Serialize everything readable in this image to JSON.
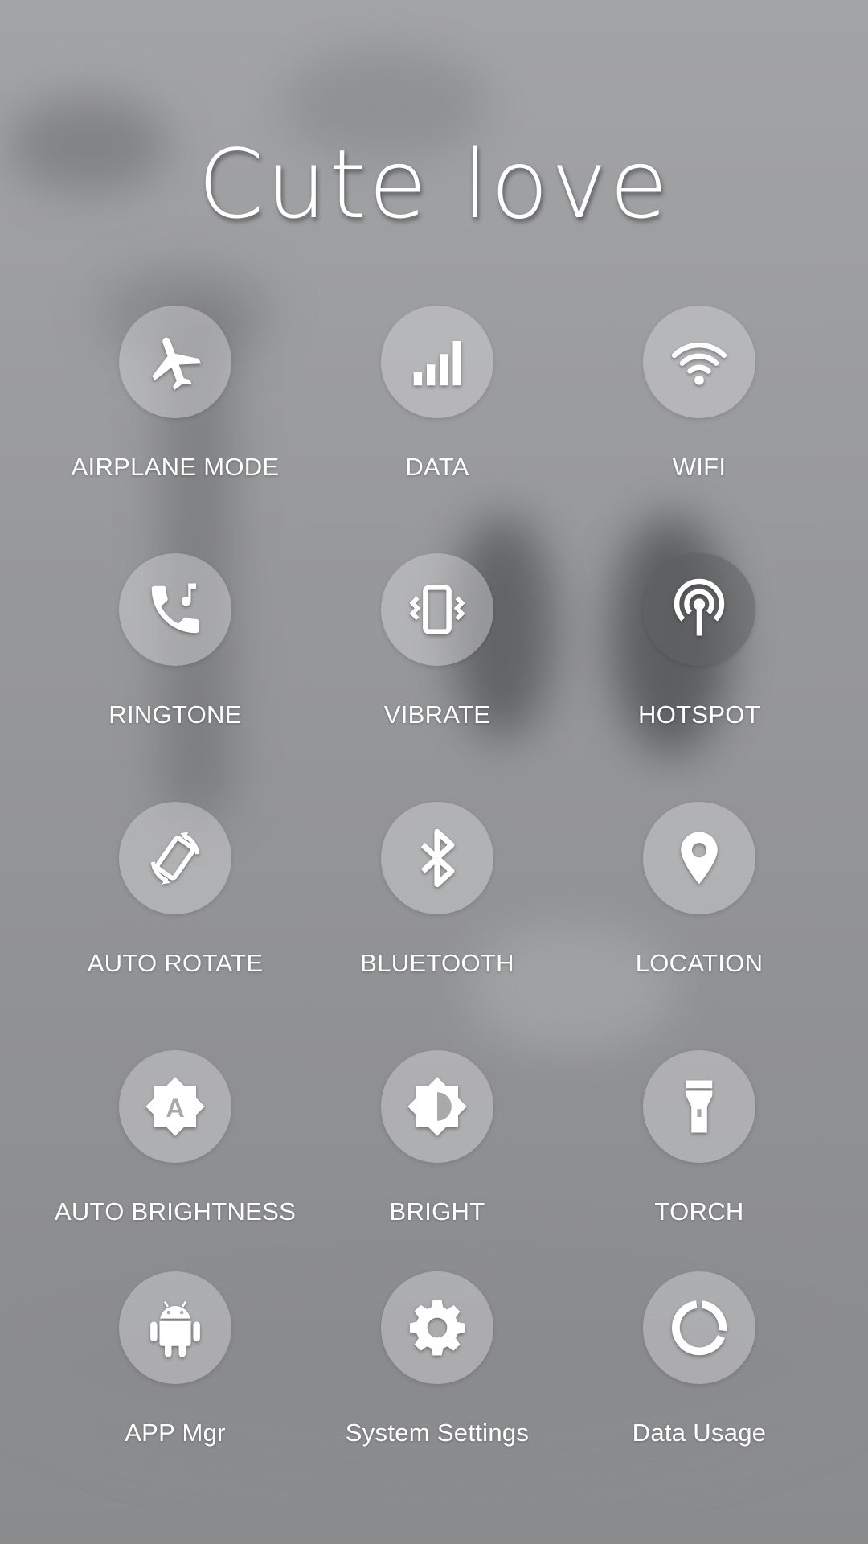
{
  "header": {
    "title": "Cute love"
  },
  "tiles": [
    {
      "label": "AIRPLANE MODE",
      "icon": "airplane-icon"
    },
    {
      "label": "DATA",
      "icon": "signal-bars-icon"
    },
    {
      "label": "WIFI",
      "icon": "wifi-icon"
    },
    {
      "label": "RINGTONE",
      "icon": "phone-ringtone-icon"
    },
    {
      "label": "VIBRATE",
      "icon": "vibrate-icon"
    },
    {
      "label": "HOTSPOT",
      "icon": "hotspot-icon"
    },
    {
      "label": "AUTO ROTATE",
      "icon": "auto-rotate-icon"
    },
    {
      "label": "BLUETOOTH",
      "icon": "bluetooth-icon"
    },
    {
      "label": "LOCATION",
      "icon": "location-pin-icon"
    },
    {
      "label": "AUTO BRIGHTNESS",
      "icon": "auto-brightness-icon"
    },
    {
      "label": "BRIGHT",
      "icon": "brightness-icon"
    },
    {
      "label": "TORCH",
      "icon": "flashlight-icon"
    },
    {
      "label": "APP Mgr",
      "icon": "android-icon"
    },
    {
      "label": "System Settings",
      "icon": "gear-icon"
    },
    {
      "label": "Data Usage",
      "icon": "data-usage-icon"
    }
  ]
}
